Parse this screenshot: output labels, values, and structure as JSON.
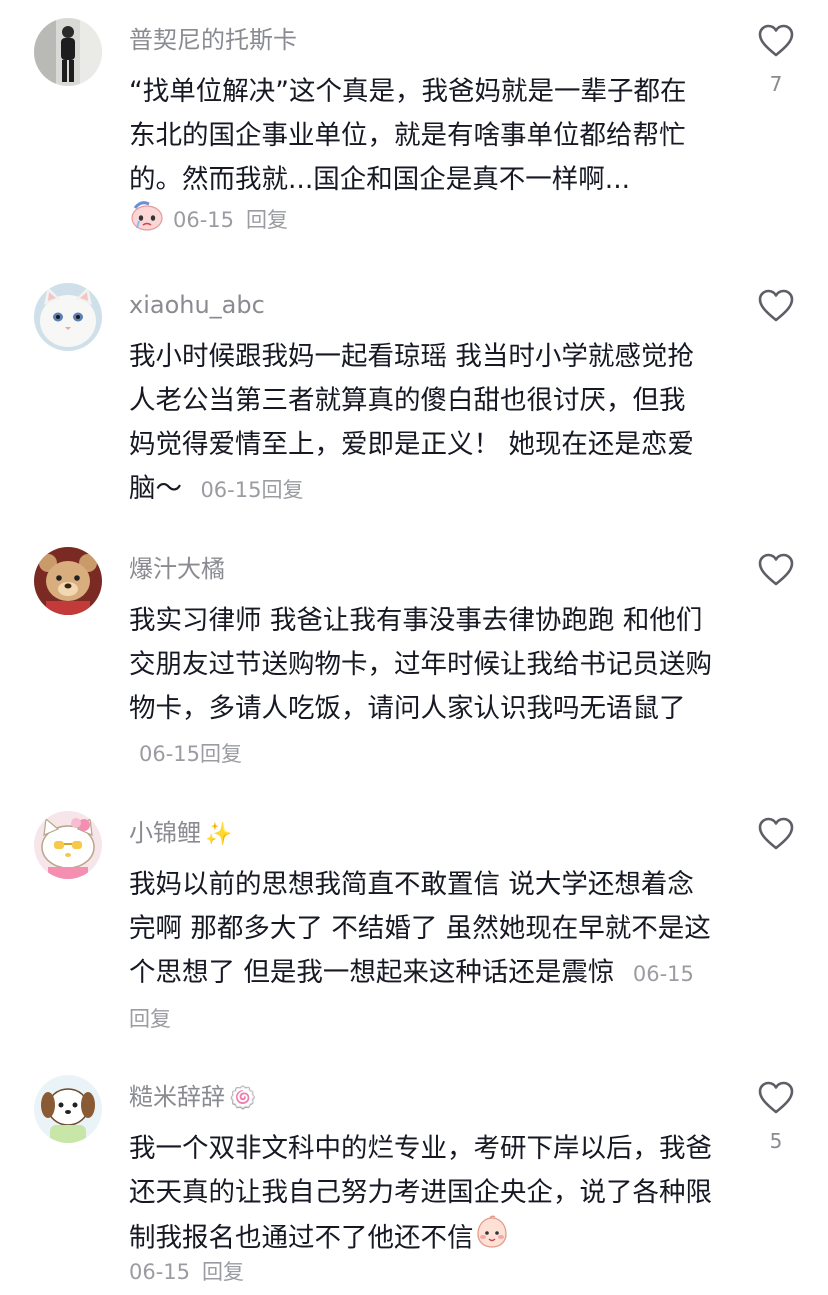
{
  "comments": [
    {
      "username": "普契尼的托斯卡",
      "text": "“找单位解决”这个真是，我爸妈就是一辈子都在东北的国企事业单位，就是有啥事单位都给帮忙的。然而我就...国企和国企是真不一样啊...",
      "date": "06-15",
      "reply": "回复",
      "likes": "7",
      "avatar_icon": "person-photo-avatar",
      "sticker": "crying-face-sticker"
    },
    {
      "username": "xiaohu_abc",
      "text": "我小时候跟我妈一起看琼瑶 我当时小学就感觉抢人老公当第三者就算真的傻白甜也很讨厌，但我妈觉得爱情至上，爱即是正义！ 她现在还是恋爱脑～",
      "date": "06-15",
      "reply": "回复",
      "likes": "",
      "avatar_icon": "white-cat-avatar"
    },
    {
      "username": "爆汁大橘",
      "text": "我实习律师 我爸让我有事没事去律协跑跑 和他们交朋友过节送购物卡，过年时候让我给书记员送购物卡，多请人吃饭，请问人家认识我吗无语鼠了",
      "date": "06-15",
      "reply": "回复",
      "likes": "",
      "avatar_icon": "teddy-bear-avatar"
    },
    {
      "username": "小锦鲤",
      "name_emoji": "✨",
      "text": "我妈以前的思想我简直不敢置信 说大学还想着念完啊 那都多大了 不结婚了 虽然她现在早就不是这个思想了 但是我一想起来这种话还是震惊",
      "date": "06-15",
      "reply": "回复",
      "likes": "",
      "avatar_icon": "hello-kitty-avatar"
    },
    {
      "username": "糙米辞辞",
      "name_emoji": "🍥",
      "text": "我一个双非文科中的烂专业，考研下岸以后，我爸还天真的让我自己努力考进国企央企，说了各种限制我报名也通过不了他还不信",
      "date": "06-15",
      "reply": "回复",
      "likes": "5",
      "avatar_icon": "cartoon-dog-avatar",
      "sticker": "blushing-face-sticker"
    }
  ]
}
